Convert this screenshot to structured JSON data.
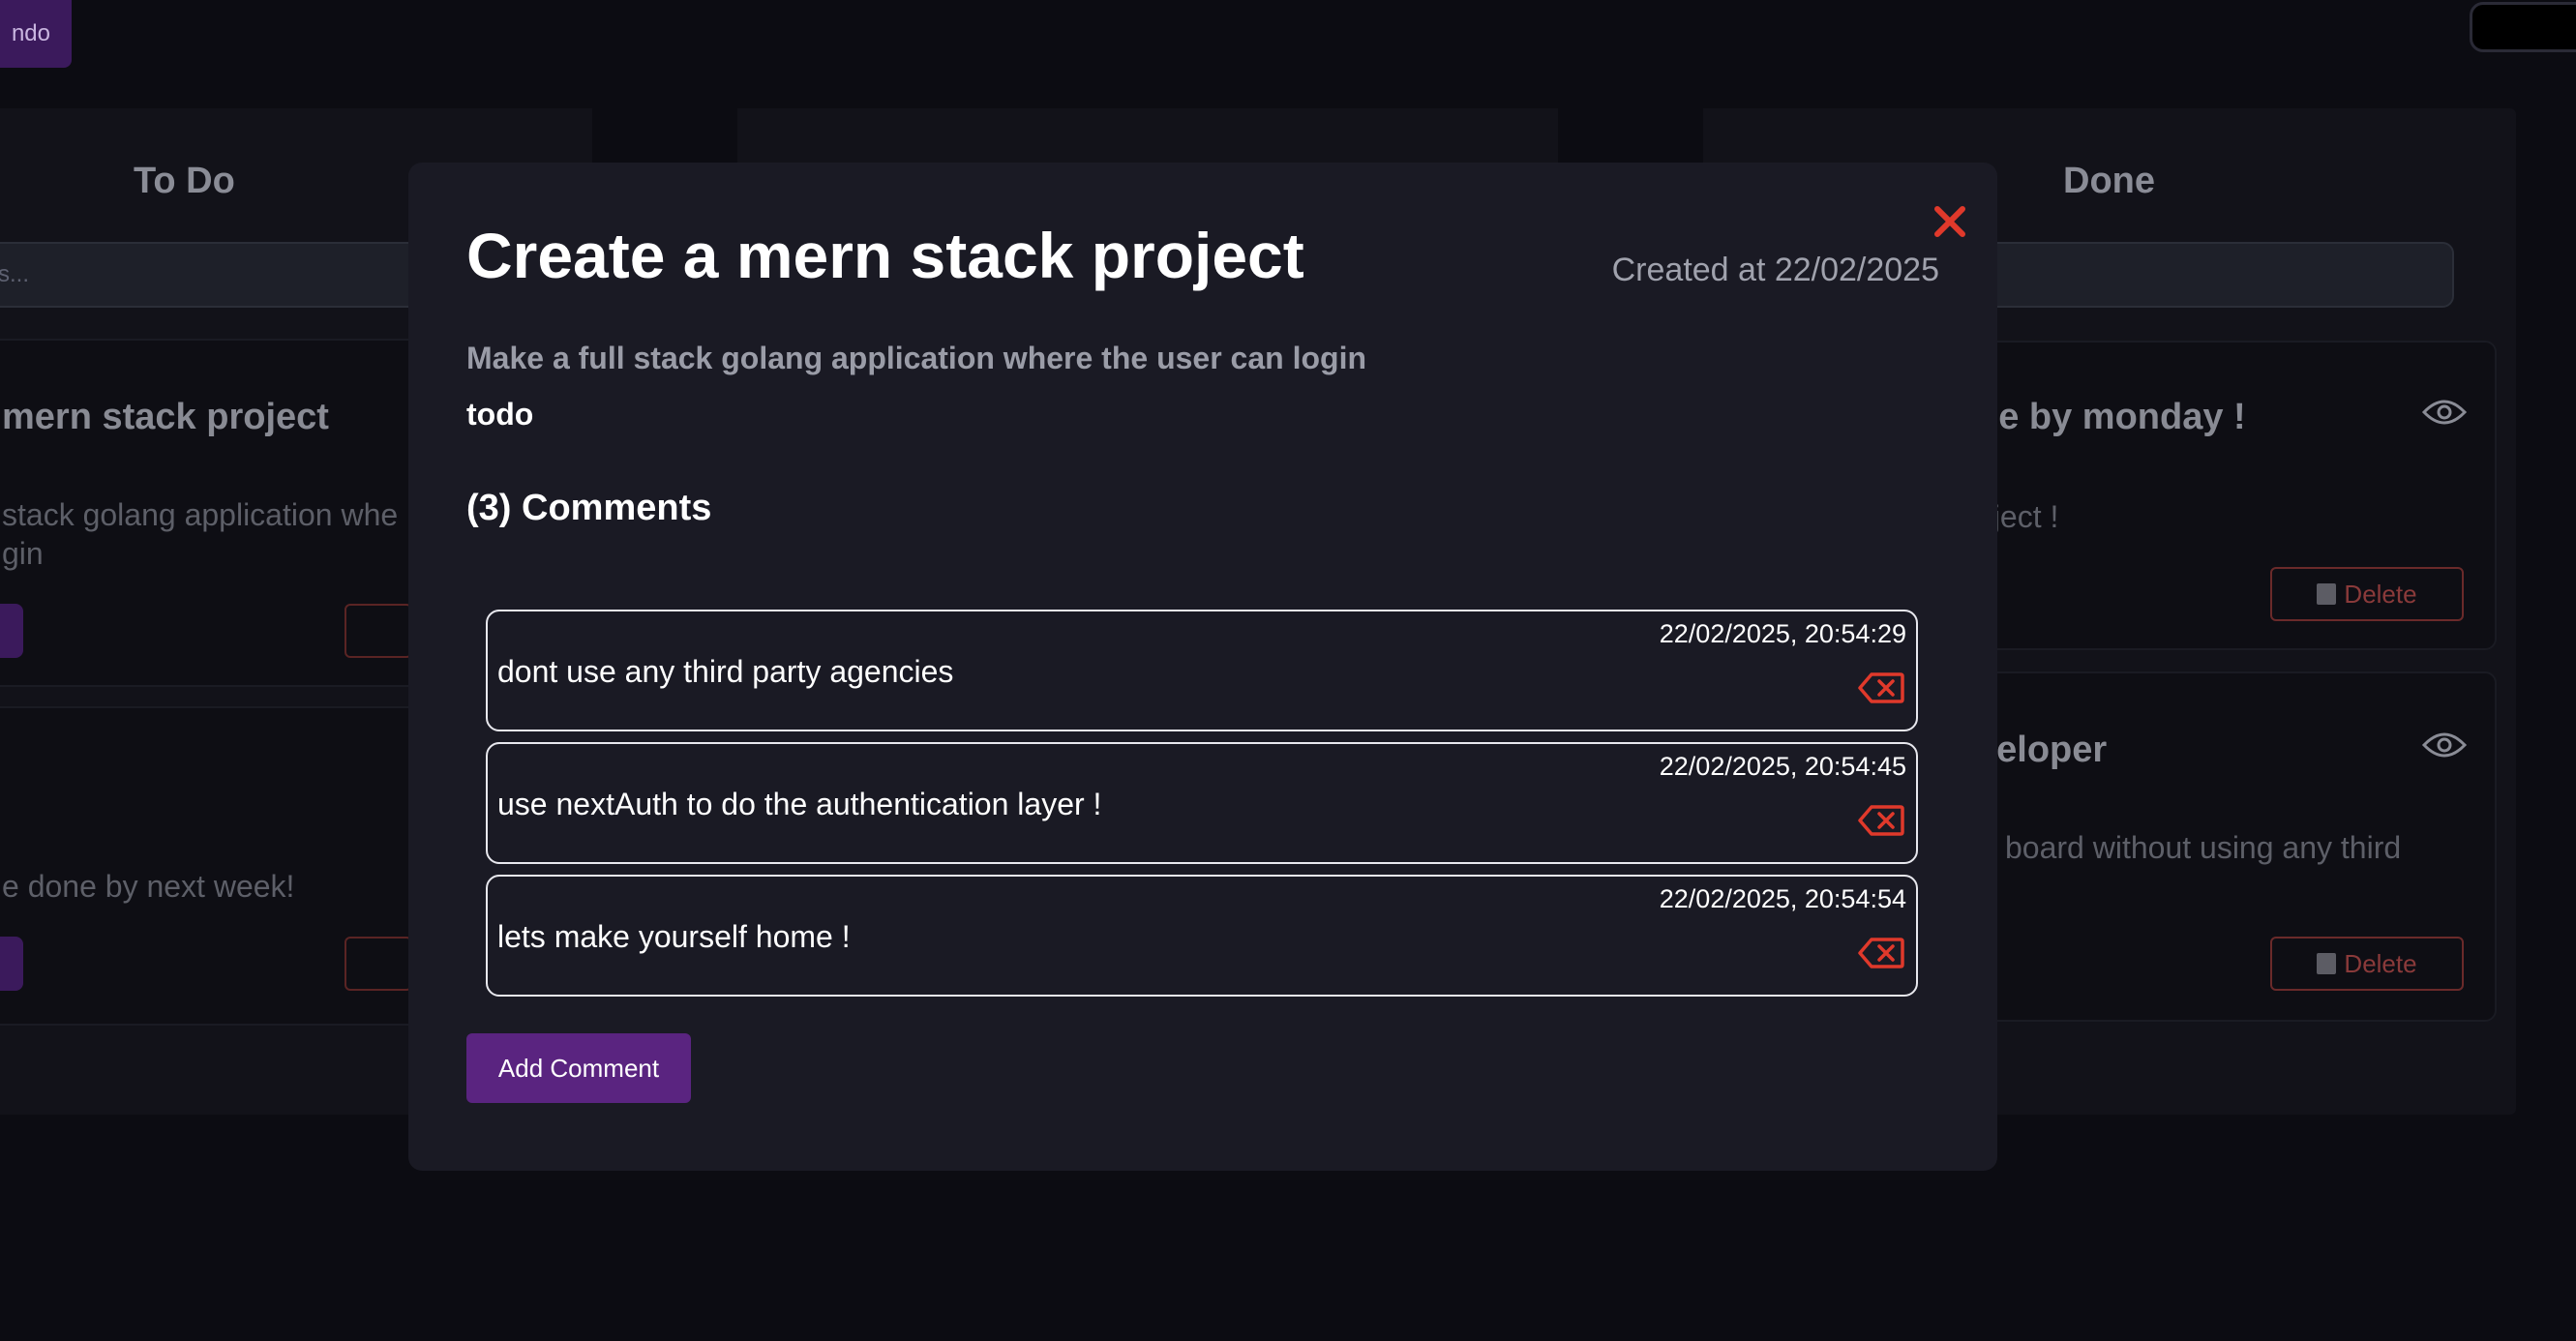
{
  "topbar": {
    "left_button_label": "ndo"
  },
  "columns": {
    "todo": {
      "title": "To Do",
      "search_placeholder": "ks..."
    },
    "done": {
      "title": "Done"
    }
  },
  "background_cards": {
    "todo_card_1": {
      "title": "mern stack project",
      "desc_line1": "stack golang application whe",
      "desc_line2": "gin"
    },
    "todo_card_2": {
      "desc": "e done by next week!"
    },
    "done_card_1": {
      "title": "ne by monday !",
      "desc": "oject !",
      "delete_label": "Delete"
    },
    "done_card_2": {
      "title": "veloper",
      "desc": "board without using any third",
      "delete_label": "Delete"
    }
  },
  "modal": {
    "title": "Create a mern stack project",
    "created_label": "Created at 22/02/2025",
    "description": "Make a full stack golang application where the user can login",
    "status": "todo",
    "comments_header": "(3) Comments",
    "comments": [
      {
        "timestamp": "22/02/2025, 20:54:29",
        "text": "dont use any third party agencies"
      },
      {
        "timestamp": "22/02/2025, 20:54:45",
        "text": "use nextAuth to do the authentication layer !"
      },
      {
        "timestamp": "22/02/2025, 20:54:54",
        "text": "lets make yourself home !"
      }
    ],
    "add_comment_label": "Add Comment"
  },
  "colors": {
    "accent_purple": "#5a2480",
    "danger_red": "#e0392b",
    "modal_bg": "#1a1a24"
  },
  "icons": {
    "close": "close-x-icon",
    "eye": "eye-icon",
    "trash": "trash-icon",
    "comment_delete": "backspace-delete-icon"
  }
}
